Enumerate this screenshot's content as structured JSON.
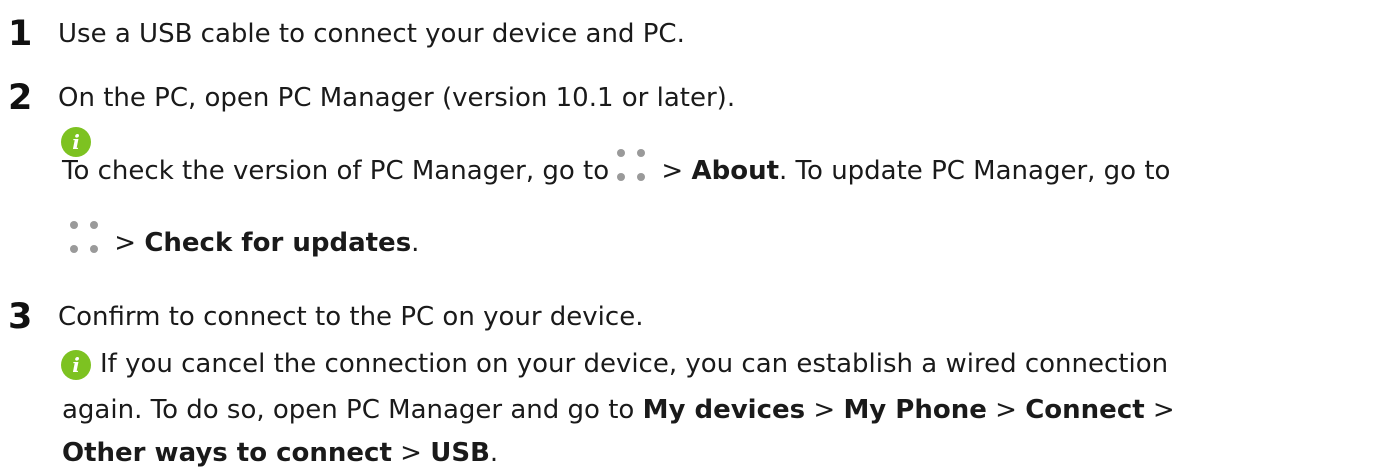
{
  "steps": [
    {
      "number": "1",
      "text": "Use a USB cable to connect your device and PC."
    },
    {
      "number": "2",
      "text": "On the PC, open PC Manager (version 10.1 or later)."
    },
    {
      "number": "3",
      "text": "Confirm to connect to the PC on your device."
    }
  ],
  "note1": {
    "icon": "info-icon",
    "icon_glyph": "i",
    "part1": "To check the version of PC Manager, go to",
    "sep1": " > ",
    "bold1": "About",
    "part2": ". To update PC Manager, go to",
    "sep2": " > ",
    "bold2": "Check for updates",
    "end": "."
  },
  "note2": {
    "icon": "info-icon",
    "icon_glyph": "i",
    "line1": "If you cancel the connection on your device, you can establish a wired connection",
    "line2_text": "again. To do so, open PC Manager and go to ",
    "bold1": "My devices",
    "sep1": " > ",
    "bold2": "My Phone",
    "sep2": " > ",
    "bold3": "Connect",
    "sep3": " >",
    "bold4": "Other ways to connect",
    "sep4": " > ",
    "bold5": "USB",
    "end": "."
  },
  "colors": {
    "icon_green": "#7dc221",
    "dots_gray": "#9a9a9a",
    "text": "#1a1a1a"
  }
}
